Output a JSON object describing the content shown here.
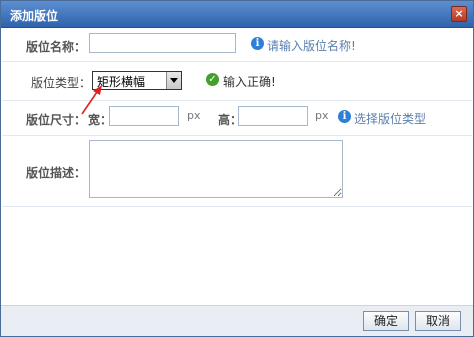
{
  "dialog": {
    "title": "添加版位",
    "close_label": "×"
  },
  "form": {
    "name": {
      "label": "版位名称：",
      "value": "",
      "hint": "请输入版位名称!"
    },
    "type": {
      "label": "版位类型：",
      "selected": "矩形横幅",
      "hint": "输入正确!"
    },
    "size": {
      "label": "版位尺寸：",
      "width_label": "宽：",
      "width_value": "",
      "width_unit": "px",
      "height_label": "高：",
      "height_value": "",
      "height_unit": "px",
      "hint": "选择版位类型"
    },
    "description": {
      "label": "版位描述：",
      "value": ""
    }
  },
  "footer": {
    "confirm_label": "确定",
    "cancel_label": "取消"
  },
  "icons": {
    "info": "info-icon",
    "ok": "checkmark-icon",
    "arrow_color": "#e02020"
  }
}
